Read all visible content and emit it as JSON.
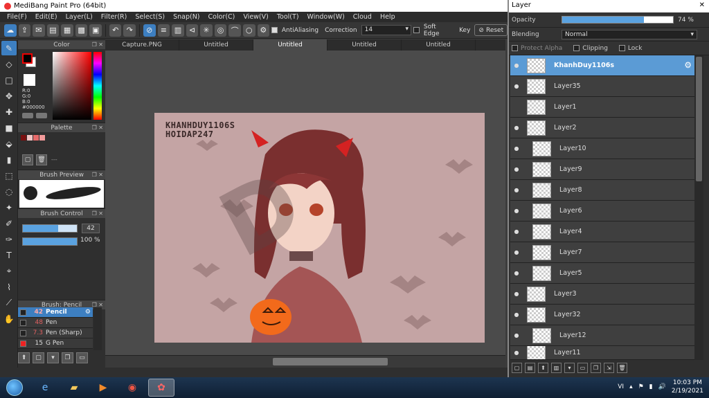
{
  "window": {
    "title": "MediBang Paint Pro (64bit)"
  },
  "menu": [
    "File(F)",
    "Edit(E)",
    "Layer(L)",
    "Filter(R)",
    "Select(S)",
    "Snap(N)",
    "Color(C)",
    "View(V)",
    "Tool(T)",
    "Window(W)",
    "Cloud",
    "Help"
  ],
  "toolbar": {
    "antialiasing_label": "AntiAliasing",
    "correction_label": "Correction",
    "correction_value": "14",
    "soft_edge_label": "Soft Edge",
    "key_label": "Key",
    "reset_label": "Reset"
  },
  "panels": {
    "color": {
      "title": "Color",
      "r": "R:0",
      "g": "G:0",
      "b": "B:0",
      "hex": "#000000"
    },
    "palette": {
      "title": "Palette",
      "dash": "---"
    },
    "brush_preview": {
      "title": "Brush Preview"
    },
    "brush_control": {
      "title": "Brush Control",
      "size_value": "42",
      "size_fraction": 0.65,
      "opacity_value": "100 %",
      "opacity_fraction": 1.0
    },
    "brush_list": {
      "title": "Brush: Pencil",
      "items": [
        {
          "size": "42",
          "name": "Pencil"
        },
        {
          "size": "48",
          "name": "Pen"
        },
        {
          "size": "7.3",
          "name": "Pen (Sharp)"
        },
        {
          "size": "15",
          "name": "G Pen"
        }
      ]
    }
  },
  "tabs": [
    "Capture.PNG",
    "Untitled",
    "Untitled",
    "Untitled",
    "Untitled"
  ],
  "canvas": {
    "watermark_line1": "KHANHDUY1106S",
    "watermark_line2": "HOIDAP247"
  },
  "layer_panel": {
    "title": "Layer",
    "opacity_label": "Opacity",
    "opacity_value": "74 %",
    "opacity_fraction": 0.74,
    "blending_label": "Blending",
    "blending_value": "Normal",
    "protect_alpha": "Protect Alpha",
    "clipping": "Clipping",
    "lock": "Lock",
    "layers": [
      {
        "name": "KhanhDuy1106s"
      },
      {
        "name": "Layer35"
      },
      {
        "name": "Layer1"
      },
      {
        "name": "Layer2"
      },
      {
        "name": "Layer10"
      },
      {
        "name": "Layer9"
      },
      {
        "name": "Layer8"
      },
      {
        "name": "Layer6"
      },
      {
        "name": "Layer4"
      },
      {
        "name": "Layer7"
      },
      {
        "name": "Layer5"
      },
      {
        "name": "Layer3"
      },
      {
        "name": "Layer32"
      },
      {
        "name": "Layer12"
      },
      {
        "name": "Layer11"
      }
    ]
  },
  "taskbar": {
    "lang": "VI",
    "time": "10:03 PM",
    "date": "2/19/2021"
  },
  "colors": {
    "accent": "#3d7fc1",
    "selected_layer": "#5b9bd5",
    "canvas_bg": "#c4a4a4"
  }
}
